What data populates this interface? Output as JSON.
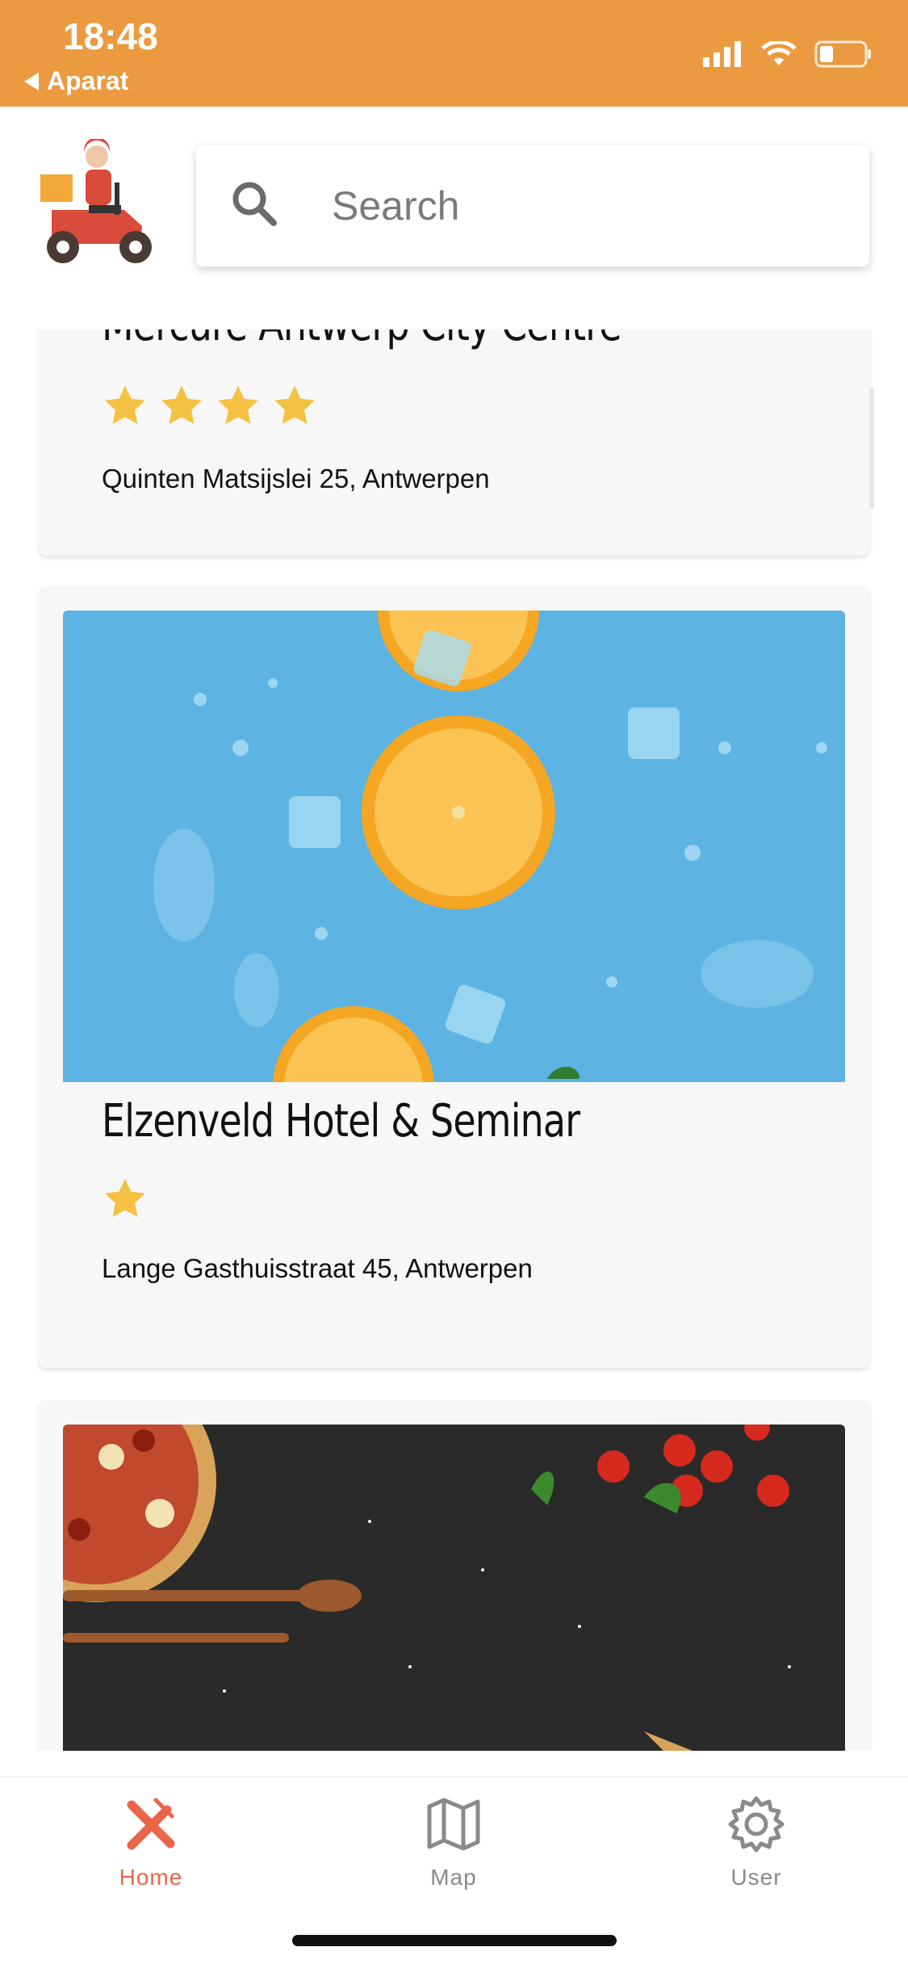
{
  "status_bar": {
    "time": "18:48",
    "back_app": "Aparat"
  },
  "search": {
    "placeholder": "Search"
  },
  "cards": [
    {
      "title": "Mercure Antwerp City Centre",
      "stars": 4,
      "address": "Quinten Matsijslei 25, Antwerpen"
    },
    {
      "title": "Elzenveld Hotel & Seminar",
      "stars": 1,
      "address": "Lange Gasthuisstraat 45, Antwerpen"
    },
    {
      "title": "",
      "stars": 0,
      "address": ""
    }
  ],
  "tabs": [
    {
      "label": "Home",
      "icon": "fork-knife-icon",
      "active": true
    },
    {
      "label": "Map",
      "icon": "map-icon",
      "active": false
    },
    {
      "label": "User",
      "icon": "gear-icon",
      "active": false
    }
  ],
  "colors": {
    "accent": "#EB9A3F",
    "active_tab": "#E8664A",
    "inactive_tab": "#8a8a8a",
    "star": "#F5C142"
  }
}
